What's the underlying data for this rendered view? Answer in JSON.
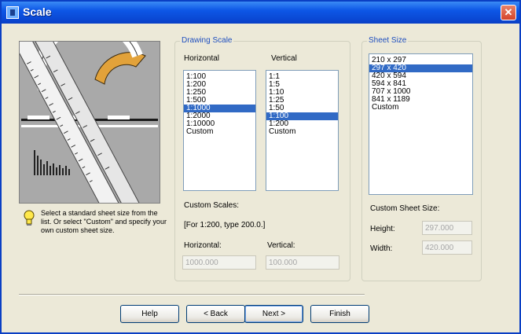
{
  "window": {
    "title": "Scale",
    "close": "✕"
  },
  "hint_text": "Select a standard sheet size from the list. Or select \"Custom\" and specify your own custom sheet size.",
  "drawing_scale": {
    "title": "Drawing Scale",
    "horizontal_label": "Horizontal",
    "vertical_label": "Vertical",
    "horizontal_items": [
      "1:100",
      "1:200",
      "1:250",
      "1:500",
      "1:1000",
      "1:2000",
      "1:10000",
      "Custom"
    ],
    "horizontal_selected": "1:1000",
    "vertical_items": [
      "1:1",
      "1:5",
      "1:10",
      "1:25",
      "1:50",
      "1:100",
      "1:200",
      "Custom"
    ],
    "vertical_selected": "1:100",
    "custom_scales_label": "Custom Scales:",
    "custom_example": "[For 1:200, type 200.0.]",
    "horizontal_field_label": "Horizontal:",
    "vertical_field_label": "Vertical:",
    "horizontal_value": "1000.000",
    "vertical_value": "100.000"
  },
  "sheet_size": {
    "title": "Sheet Size",
    "items": [
      "210 x 297",
      "297 x 420",
      "420 x 594",
      "594 x 841",
      "707 x 1000",
      "841 x 1189",
      "Custom"
    ],
    "selected": "297 x 420",
    "custom_label": "Custom Sheet Size:",
    "height_label": "Height:",
    "width_label": "Width:",
    "height_value": "297.000",
    "width_value": "420.000"
  },
  "buttons": {
    "help": "Help",
    "back": "< Back",
    "next": "Next >",
    "finish": "Finish"
  },
  "colors": {
    "title_bar": "#0a48d4",
    "selection": "#316ac5",
    "group_label": "#1f4fbf",
    "dialog_bg": "#ece9d8"
  },
  "icons": [
    "window-icon",
    "close-icon",
    "lightbulb-icon",
    "scale-ruler-illustration"
  ]
}
